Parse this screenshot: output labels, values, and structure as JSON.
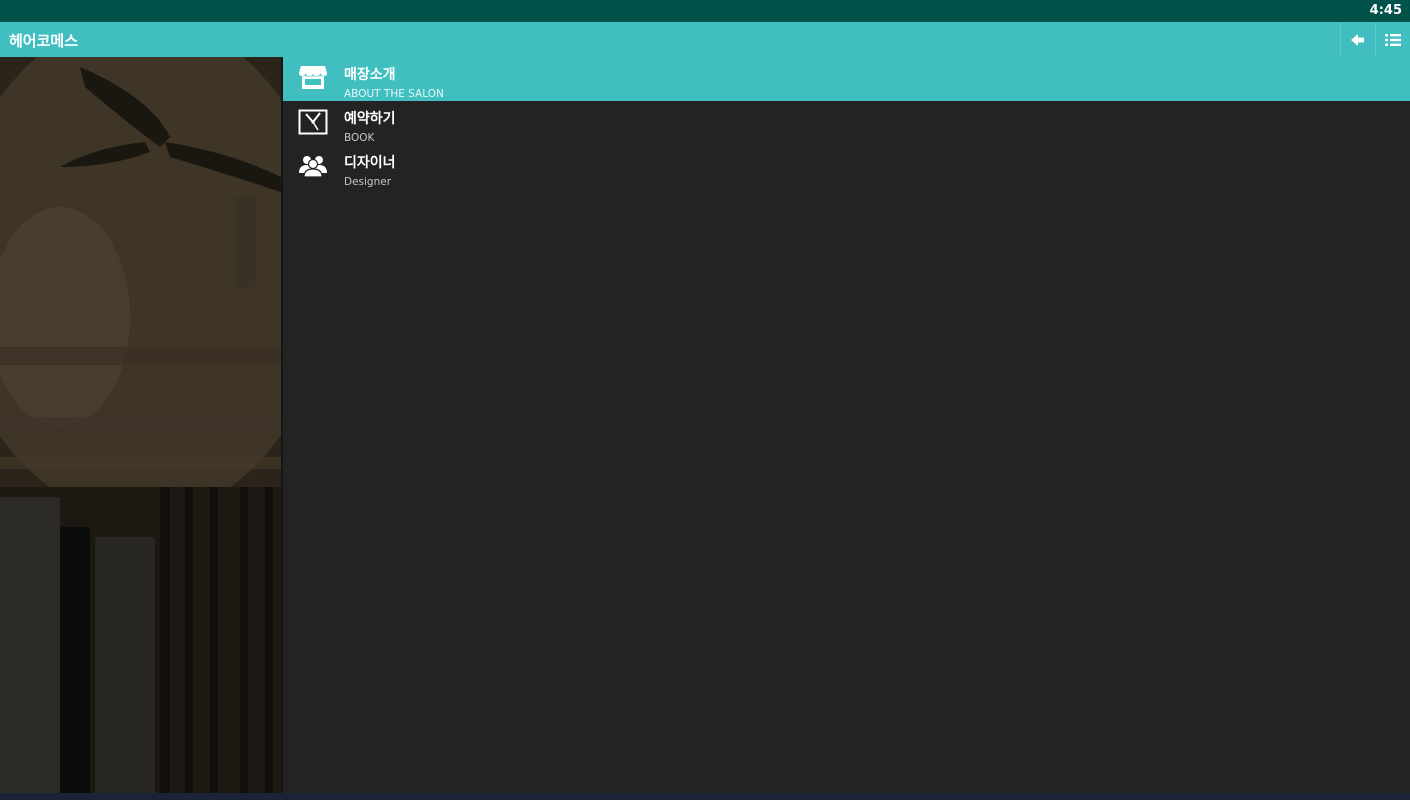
{
  "status_bar": {
    "time": "4:45"
  },
  "app_bar": {
    "title": "헤어코메스",
    "actions": [
      {
        "icon": "back-arrow-icon"
      },
      {
        "icon": "list-menu-icon"
      }
    ]
  },
  "menu": {
    "items": [
      {
        "label": "매장소개",
        "sublabel": "ABOUT THE SALON",
        "icon": "storefront-icon",
        "active": true
      },
      {
        "label": "예약하기",
        "sublabel": "BOOK",
        "icon": "clock-icon",
        "active": false
      },
      {
        "label": "디자이너",
        "sublabel": "Designer",
        "icon": "people-icon",
        "active": false
      }
    ]
  },
  "colors": {
    "status_bar": "#00524b",
    "accent": "#41bfc0",
    "background": "#232323"
  }
}
